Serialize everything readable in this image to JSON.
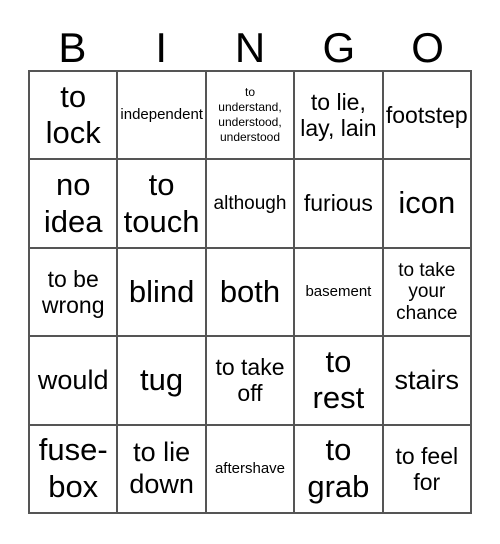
{
  "card": {
    "title": "BINGO",
    "header_letters": [
      "B",
      "I",
      "N",
      "G",
      "O"
    ],
    "columns": 5,
    "rows": 5,
    "border_color": "#555555",
    "text_color": "#000000",
    "background_color": "#ffffff",
    "cells": [
      [
        {
          "text": "to\nlock",
          "size": "fs-xl"
        },
        {
          "text": "independent",
          "size": "fs-xs"
        },
        {
          "text": "to\nunderstand,\nunderstood,\nunderstood",
          "size": "fs-xxs"
        },
        {
          "text": "to lie,\nlay, lain",
          "size": "fs-md"
        },
        {
          "text": "footstep",
          "size": "fs-md"
        }
      ],
      [
        {
          "text": "no\nidea",
          "size": "fs-xl"
        },
        {
          "text": "to\ntouch",
          "size": "fs-xl"
        },
        {
          "text": "although",
          "size": "fs-sm"
        },
        {
          "text": "furious",
          "size": "fs-md"
        },
        {
          "text": "icon",
          "size": "fs-xl"
        }
      ],
      [
        {
          "text": "to be\nwrong",
          "size": "fs-md"
        },
        {
          "text": "blind",
          "size": "fs-xl"
        },
        {
          "text": "both",
          "size": "fs-xl"
        },
        {
          "text": "basement",
          "size": "fs-xs"
        },
        {
          "text": "to take\nyour\nchance",
          "size": "fs-sm"
        }
      ],
      [
        {
          "text": "would",
          "size": "fs-lg"
        },
        {
          "text": "tug",
          "size": "fs-xl"
        },
        {
          "text": "to take\noff",
          "size": "fs-md"
        },
        {
          "text": "to\nrest",
          "size": "fs-xl"
        },
        {
          "text": "stairs",
          "size": "fs-lg"
        }
      ],
      [
        {
          "text": "fuse-\nbox",
          "size": "fs-xl"
        },
        {
          "text": "to lie\ndown",
          "size": "fs-lg"
        },
        {
          "text": "aftershave",
          "size": "fs-xs"
        },
        {
          "text": "to\ngrab",
          "size": "fs-xl"
        },
        {
          "text": "to feel\nfor",
          "size": "fs-md"
        }
      ]
    ]
  }
}
